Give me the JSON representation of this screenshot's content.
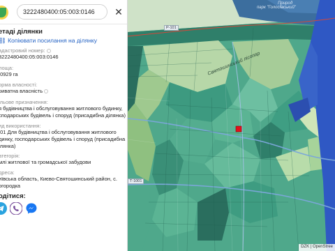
{
  "search": {
    "value": "3222480400:05:003:0146"
  },
  "panel": {
    "title": "етаді ділянки",
    "copy_link": "Копіювати посилання на ділянку",
    "fields": [
      {
        "label": "адастровий номер:",
        "value_lines": [
          "3222480400:05:003:0146"
        ]
      },
      {
        "label": "лоща:",
        "value_lines": [
          ".0929 га"
        ]
      },
      {
        "label": "орма власності:",
        "value_lines": [
          "риватна власність"
        ]
      },
      {
        "label": "ільове призначення:",
        "value_lines": [
          "я будівництва і обслуговування житлового будинку,",
          "сподарських будівель і споруд (присадибна ділянка)"
        ]
      },
      {
        "label": "ид використання:",
        "value_lines": [
          ".01 Для будівництва і обслуговування житлового",
          "динку, господарських будівель і споруд (присадибна",
          "ілянка)"
        ]
      },
      {
        "label": "атегорія:",
        "value_lines": [
          "млі житлової та громадської забудови"
        ]
      },
      {
        "label": "дреса:",
        "value_lines": [
          "иївська область, Києво-Святошинський район, с.",
          "огородка"
        ]
      }
    ],
    "share_title": "одітися:"
  },
  "share": {
    "telegram_color": "#2aa3df",
    "viber_color": "#7b519d",
    "messenger_color": "#1877f2"
  },
  "map": {
    "labels": {
      "forest": "Святошинський лісопар",
      "park_1": "Природ",
      "park_2": "парк \"Голосіївський\"",
      "road_1": "Р-101",
      "road_2": "Т-1001"
    },
    "attribution": "DZK | OpenStree"
  },
  "colors": {
    "parcel_fill": "#3f9e83",
    "selected_parcel": "#e3101a",
    "forest_fill": "#b7d7a8",
    "water_fill": "#2f58c4",
    "road_line": "#7ba7d9"
  }
}
